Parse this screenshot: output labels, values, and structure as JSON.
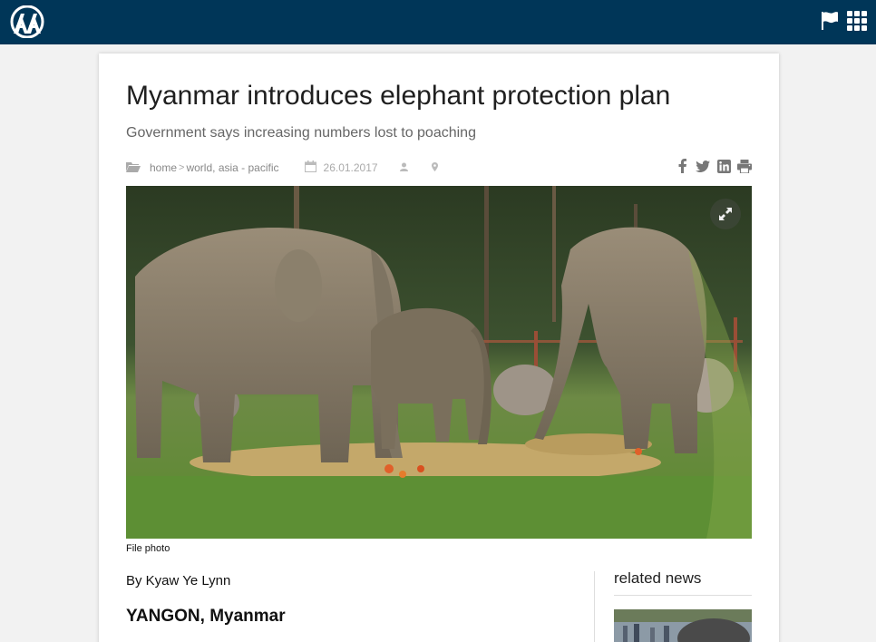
{
  "header": {
    "logo": "aa-logo-icon",
    "icons": [
      "flag-icon",
      "grid-menu-icon"
    ],
    "background": "#003658"
  },
  "article": {
    "title": "Myanmar introduces elephant protection plan",
    "subtitle": "Government says increasing numbers lost to poaching",
    "breadcrumb": {
      "home": "home",
      "separator": ">",
      "section": "world, asia - pacific"
    },
    "date": "26.01.2017",
    "meta_icons": [
      "folder-icon",
      "calendar-icon",
      "user-icon",
      "location-icon"
    ],
    "share_icons": [
      "facebook-icon",
      "twitter-icon",
      "linkedin-icon",
      "print-icon"
    ],
    "photo": "elephants-photo",
    "photo_caption": "File photo",
    "byline": "By Kyaw Ye Lynn",
    "dateline": "YANGON, Myanmar"
  },
  "sidebar": {
    "related_title": "related news"
  }
}
